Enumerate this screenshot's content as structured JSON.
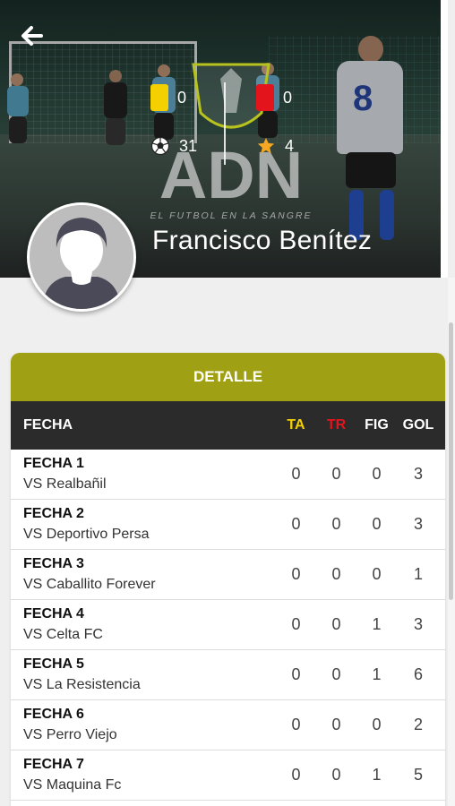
{
  "header": {
    "back_icon": "arrow-left-icon",
    "player_name": "Francisco Benítez",
    "brand": "ADN",
    "tagline": "EL FUTBOL EN LA SANGRE"
  },
  "stats": {
    "yellow_cards": "0",
    "red_cards": "0",
    "goals": "31",
    "mvp": "4"
  },
  "colors": {
    "accent": "#a0a014",
    "table_header": "#2b2b2b",
    "yellow": "#f4d000",
    "red": "#e3141c"
  },
  "table": {
    "title": "DETALLE",
    "columns": {
      "fecha": "FECHA",
      "ta": "TA",
      "tr": "TR",
      "fig": "FIG",
      "gol": "GOL"
    },
    "column_colors": {
      "ta": "#f4d000",
      "tr": "#e3141c"
    },
    "rows": [
      {
        "fecha": "FECHA 1",
        "vs": "VS Realbañil",
        "ta": "0",
        "tr": "0",
        "fig": "0",
        "gol": "3"
      },
      {
        "fecha": "FECHA 2",
        "vs": "VS Deportivo Persa",
        "ta": "0",
        "tr": "0",
        "fig": "0",
        "gol": "3"
      },
      {
        "fecha": "FECHA 3",
        "vs": "VS Caballito Forever",
        "ta": "0",
        "tr": "0",
        "fig": "0",
        "gol": "1"
      },
      {
        "fecha": "FECHA 4",
        "vs": "VS Celta FC",
        "ta": "0",
        "tr": "0",
        "fig": "1",
        "gol": "3"
      },
      {
        "fecha": "FECHA 5",
        "vs": "VS La Resistencia",
        "ta": "0",
        "tr": "0",
        "fig": "1",
        "gol": "6"
      },
      {
        "fecha": "FECHA 6",
        "vs": "VS Perro Viejo",
        "ta": "0",
        "tr": "0",
        "fig": "0",
        "gol": "2"
      },
      {
        "fecha": "FECHA 7",
        "vs": "VS Maquina Fc",
        "ta": "0",
        "tr": "0",
        "fig": "1",
        "gol": "5"
      }
    ]
  }
}
